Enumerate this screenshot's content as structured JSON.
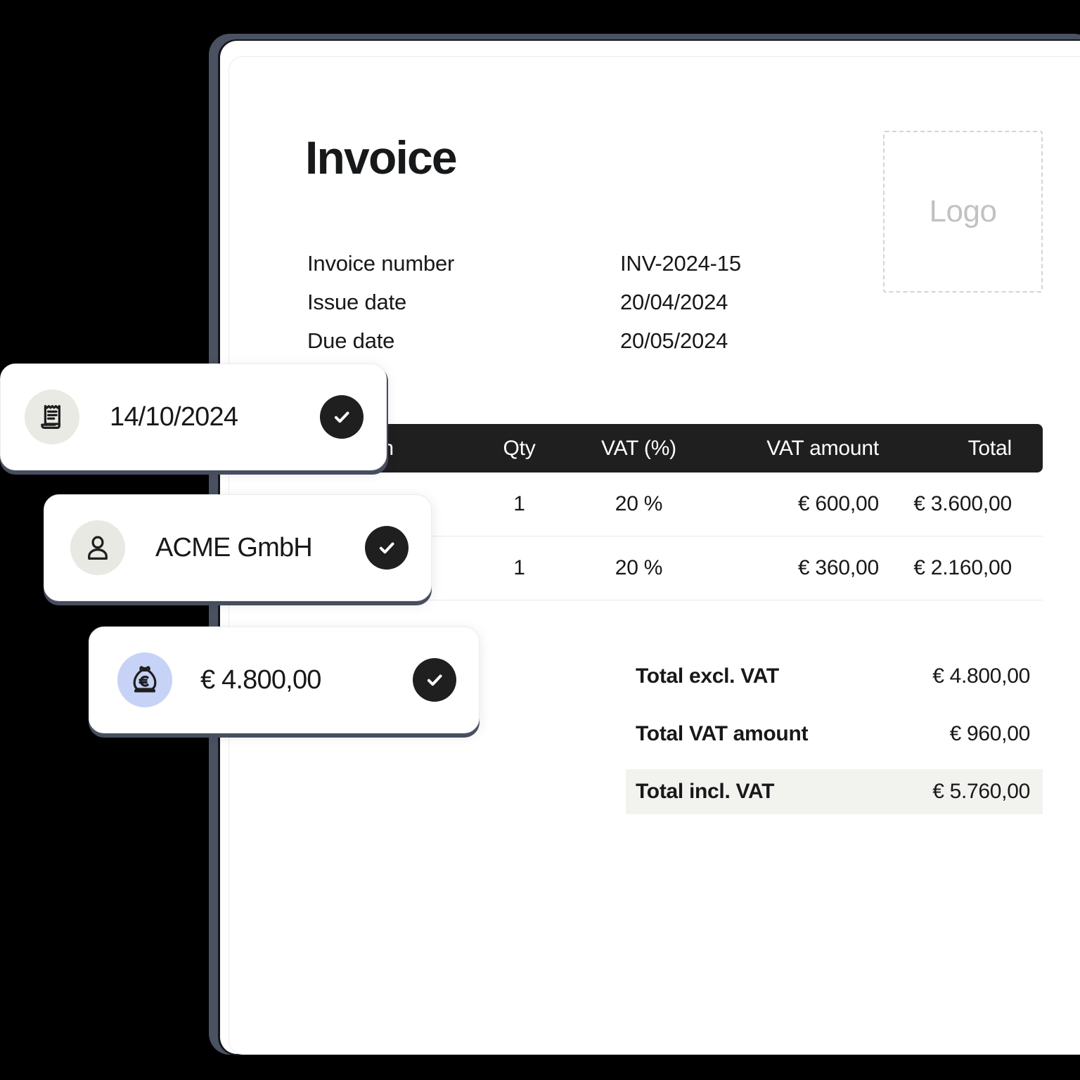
{
  "document": {
    "title": "Invoice",
    "logo_placeholder": "Logo",
    "meta": [
      {
        "label": "Invoice number",
        "value": "INV-2024-15"
      },
      {
        "label": "Issue date",
        "value": "20/04/2024"
      },
      {
        "label": "Due date",
        "value": "20/05/2024"
      }
    ],
    "table": {
      "columns": [
        "Description",
        "Qty",
        "VAT (%)",
        "VAT amount",
        "Total"
      ],
      "rows": [
        {
          "description": "",
          "qty": "1",
          "vat_percent": "20 %",
          "vat_amount": "€ 600,00",
          "total": "€ 3.600,00"
        },
        {
          "description": "",
          "qty": "1",
          "vat_percent": "20 %",
          "vat_amount": "€ 360,00",
          "total": "€ 2.160,00"
        }
      ]
    },
    "totals": [
      {
        "label": "Total excl. VAT",
        "value": "€ 4.800,00",
        "highlight": false
      },
      {
        "label": "Total VAT amount",
        "value": "€ 960,00",
        "highlight": false
      },
      {
        "label": "Total incl. VAT",
        "value": "€ 5.760,00",
        "highlight": true
      }
    ]
  },
  "floating_cards": [
    {
      "icon": "receipt-icon",
      "icon_bg": "#eaeae4",
      "label": "14/10/2024",
      "status": "check-icon"
    },
    {
      "icon": "person-icon",
      "icon_bg": "#e9e9e4",
      "label": "ACME GmbH",
      "status": "check-icon"
    },
    {
      "icon": "money-bag-icon",
      "icon_bg": "#c6d2f6",
      "label": "€ 4.800,00",
      "status": "check-icon"
    }
  ],
  "colors": {
    "background": "#000000",
    "sheet": "#ffffff",
    "table_header_bg": "#1f1f1f",
    "highlight_row_bg": "#f2f2ef",
    "shadow": "#4a5262",
    "text": "#17181a",
    "muted": "#c2c2c2"
  }
}
